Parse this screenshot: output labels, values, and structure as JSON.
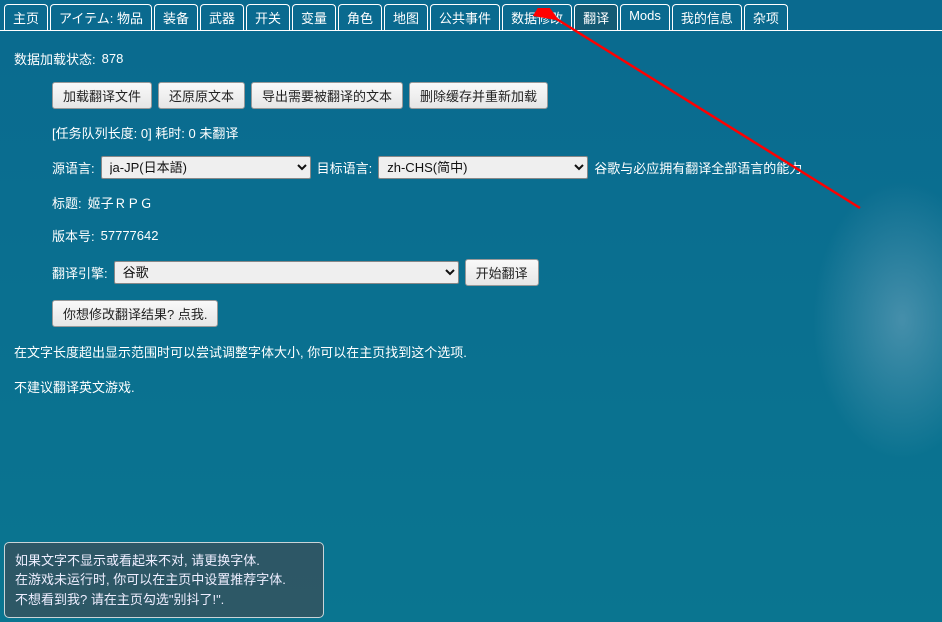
{
  "tabs": [
    {
      "label": "主页"
    },
    {
      "label": "アイテム: 物品"
    },
    {
      "label": "装备"
    },
    {
      "label": "武器"
    },
    {
      "label": "开关"
    },
    {
      "label": "变量"
    },
    {
      "label": "角色"
    },
    {
      "label": "地图"
    },
    {
      "label": "公共事件"
    },
    {
      "label": "数据修改"
    },
    {
      "label": "翻译",
      "active": true
    },
    {
      "label": "Mods"
    },
    {
      "label": "我的信息"
    },
    {
      "label": "杂项"
    }
  ],
  "status": {
    "label": "数据加载状态: ",
    "value": "878"
  },
  "buttons": {
    "loadFile": "加载翻译文件",
    "restore": "还原原文本",
    "export": "导出需要被翻译的文本",
    "deleteCache": "删除缓存并重新加载",
    "startTranslate": "开始翻译",
    "editResult": "你想修改翻译结果? 点我."
  },
  "queueLine": "[任务队列长度: 0] 耗时: 0 未翻译",
  "sourceLang": {
    "label": "源语言: ",
    "value": "ja-JP(日本語)"
  },
  "targetLang": {
    "label": " 目标语言: ",
    "value": "zh-CHS(简中)"
  },
  "langNote": " 谷歌与必应拥有翻译全部语言的能力",
  "titleLine": {
    "label": "标题: ",
    "value": "姬子ＲＰＧ"
  },
  "versionLine": {
    "label": "版本号: ",
    "value": "57777642"
  },
  "engine": {
    "label": "翻译引擎: ",
    "value": "谷歌"
  },
  "para1": "在文字长度超出显示范围时可以尝试调整字体大小, 你可以在主页找到这个选项.",
  "para2": "不建议翻译英文游戏.",
  "tooltip": {
    "l1": "如果文字不显示或看起来不对, 请更换字体.",
    "l2": "在游戏未运行时, 你可以在主页中设置推荐字体.",
    "l3": "不想看到我? 请在主页勾选\"别抖了!\"."
  }
}
